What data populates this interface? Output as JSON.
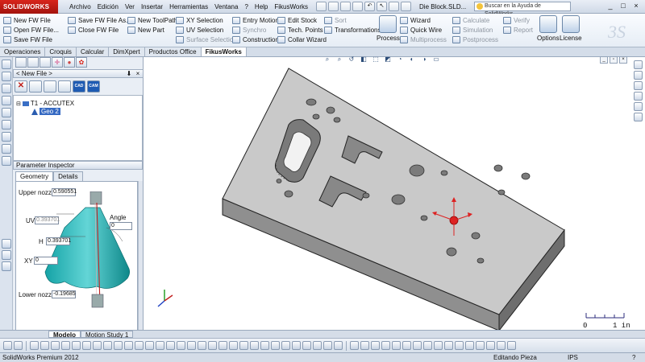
{
  "app": {
    "brand": "SOLIDWORKS",
    "document_title": "Die Block.SLD...",
    "search_placeholder": "Buscar en la Ayuda de SolidWorks"
  },
  "menu": [
    "Archivo",
    "Edición",
    "Ver",
    "Insertar",
    "Herramientas",
    "Ventana",
    "?",
    "Help",
    "FikusWorks"
  ],
  "window_controls": [
    "_",
    "□",
    "×"
  ],
  "ribbon": {
    "col1": [
      "New FW File",
      "Open FW File...",
      "Save FW File"
    ],
    "col2": [
      "Save FW File As...",
      "Close FW File"
    ],
    "col3": [
      "New ToolPath",
      "New Part"
    ],
    "col4": [
      "XY Selection",
      "UV Selection",
      "Surface Selection"
    ],
    "col5": [
      "Entry Motion",
      "Synchro",
      "Construction"
    ],
    "col6": [
      "Edit Stock",
      "Tech. Points",
      "Collar Wizard"
    ],
    "col7": [
      "Sort",
      "Transformations"
    ],
    "process": "Process",
    "col8": [
      "Wizard",
      "Quick Wire",
      "Multiprocess"
    ],
    "col9": [
      "Calculate",
      "Simulation",
      "Postprocess"
    ],
    "col10": [
      "Verify",
      "Report"
    ],
    "options": "Options",
    "license": "License"
  },
  "tabs": [
    "Operaciones",
    "Croquis",
    "Calcular",
    "DimXpert",
    "Productos Office",
    "FikusWorks"
  ],
  "active_tab": "FikusWorks",
  "fw_panel": {
    "header": "< New File >",
    "tool_cad": "CAD",
    "tool_cam": "CAM",
    "tree_root": "T1 - ACCUTEX",
    "tree_child": "Geo 2"
  },
  "param_inspector": {
    "header": "Parameter Inspector",
    "tabs": [
      "Geometry",
      "Details"
    ],
    "upper_nozzle_label": "Upper nozzle",
    "upper_nozzle_value": "0.590551",
    "uv_label": "UV",
    "uv_value": "0.393701",
    "angle_label": "Angle",
    "angle_value": "0",
    "h_label": "H",
    "h_value": "0.393701",
    "xy_label": "XY",
    "xy_value": "0",
    "lower_nozzle_label": "Lower nozzle",
    "lower_nozzle_value": "-0.19685"
  },
  "scale_bar": {
    "start": "0",
    "end": "1 in"
  },
  "bottom_tabs": [
    "Modelo",
    "Motion Study 1"
  ],
  "status": {
    "product": "SolidWorks Premium 2012",
    "mode": "Editando Pieza",
    "units": "IPS",
    "help": "?"
  }
}
